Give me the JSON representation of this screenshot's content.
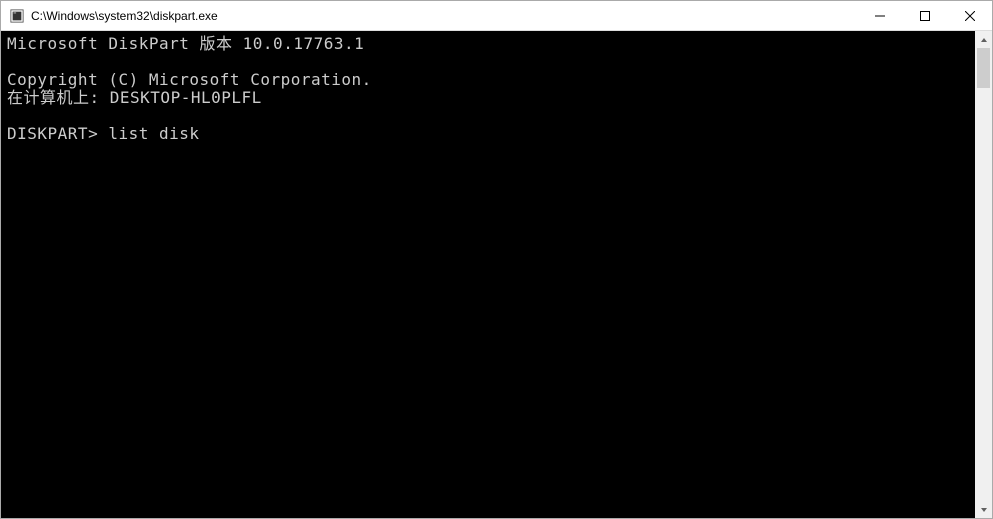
{
  "titlebar": {
    "title": "C:\\Windows\\system32\\diskpart.exe"
  },
  "console": {
    "line1": "Microsoft DiskPart 版本 10.0.17763.1",
    "line2": "",
    "line3": "Copyright (C) Microsoft Corporation.",
    "line4": "在计算机上: DESKTOP-HL0PLFL",
    "line5": "",
    "prompt": "DISKPART> ",
    "command": "list disk"
  }
}
